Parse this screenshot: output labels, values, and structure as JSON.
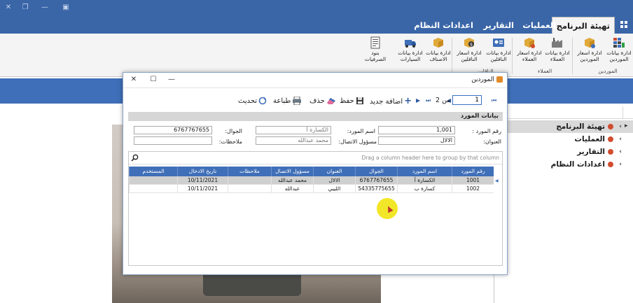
{
  "ribbon": {
    "tabs": [
      {
        "label": "تهيئة البرنامج",
        "active": true
      },
      {
        "label": "العمليات",
        "active": false
      },
      {
        "label": "التقارير",
        "active": false
      },
      {
        "label": "اعدادات النظام",
        "active": false
      }
    ],
    "buttons": [
      {
        "label": "ادارة بيانات الموردين",
        "icon": "grid-table-icon"
      },
      {
        "label": "ادارة اسعار الموردين",
        "icon": "box-price-icon"
      },
      {
        "label": "ادارة بيانات العملاء",
        "icon": "factory-icon"
      },
      {
        "label": "ادارة اسعار العملاء",
        "icon": "box-price-icon"
      },
      {
        "label": "ادارة بيانات الناقلين",
        "icon": "contact-card-icon"
      },
      {
        "label": "ادارة اسعار الناقلين",
        "icon": "money-box-icon"
      },
      {
        "label": "ادارة بيانات الاصناف",
        "icon": "box-icon"
      },
      {
        "label": "ادارة بيانات السيارات",
        "icon": "truck-icon"
      },
      {
        "label": "بنود الصرفيات",
        "icon": "document-icon"
      }
    ],
    "groups": [
      {
        "label": "الموردين"
      },
      {
        "label": "العملاء"
      },
      {
        "label": "الناقلين"
      }
    ]
  },
  "nav": {
    "items": [
      {
        "label": "تهيئة البرنامج"
      },
      {
        "label": "العمليات"
      },
      {
        "label": "التقارير"
      },
      {
        "label": "اعدادات النظام"
      }
    ]
  },
  "dialog": {
    "title": "الموردين",
    "toolbar": {
      "page_value": "1",
      "of_label": "من 2",
      "add_label": "اضافة جديد",
      "save_label": "حفظ",
      "delete_label": "حذف",
      "print_label": "طباعة",
      "refresh_label": "تحديث"
    },
    "section_title": "بيانات المورد",
    "form": {
      "supplier_no_label": "رقم المورد :",
      "supplier_no_value": "1,001",
      "supplier_name_label": "اسم المورد:",
      "supplier_name_value": "الكسارة أ",
      "mobile_label": "الجوال:",
      "mobile_value": "6767767655",
      "address_label": "العنوان:",
      "address_value": "الالال",
      "contact_label": "مسؤول الاتصال:",
      "contact_value": "محمد عبدالله",
      "notes_label": "ملاحظات:",
      "notes_value": ""
    },
    "grid": {
      "group_hint": "Drag a column header here to group by that column",
      "columns": [
        "رقم المورد",
        "اسم المورد",
        "الجوال",
        "العنوان",
        "مسؤول الاتصال",
        "ملاحظات",
        "تاريخ الادخال",
        "المستخدم"
      ],
      "rows": [
        [
          "1001",
          "الكسارة أ",
          "6767767655",
          "الالال",
          "محمد عبدالله",
          "",
          "10/11/2021",
          ""
        ],
        [
          "1002",
          "كسارة ب",
          "54335775655",
          "الليبي",
          "عبدالله",
          "",
          "10/11/2021",
          ""
        ]
      ]
    }
  }
}
